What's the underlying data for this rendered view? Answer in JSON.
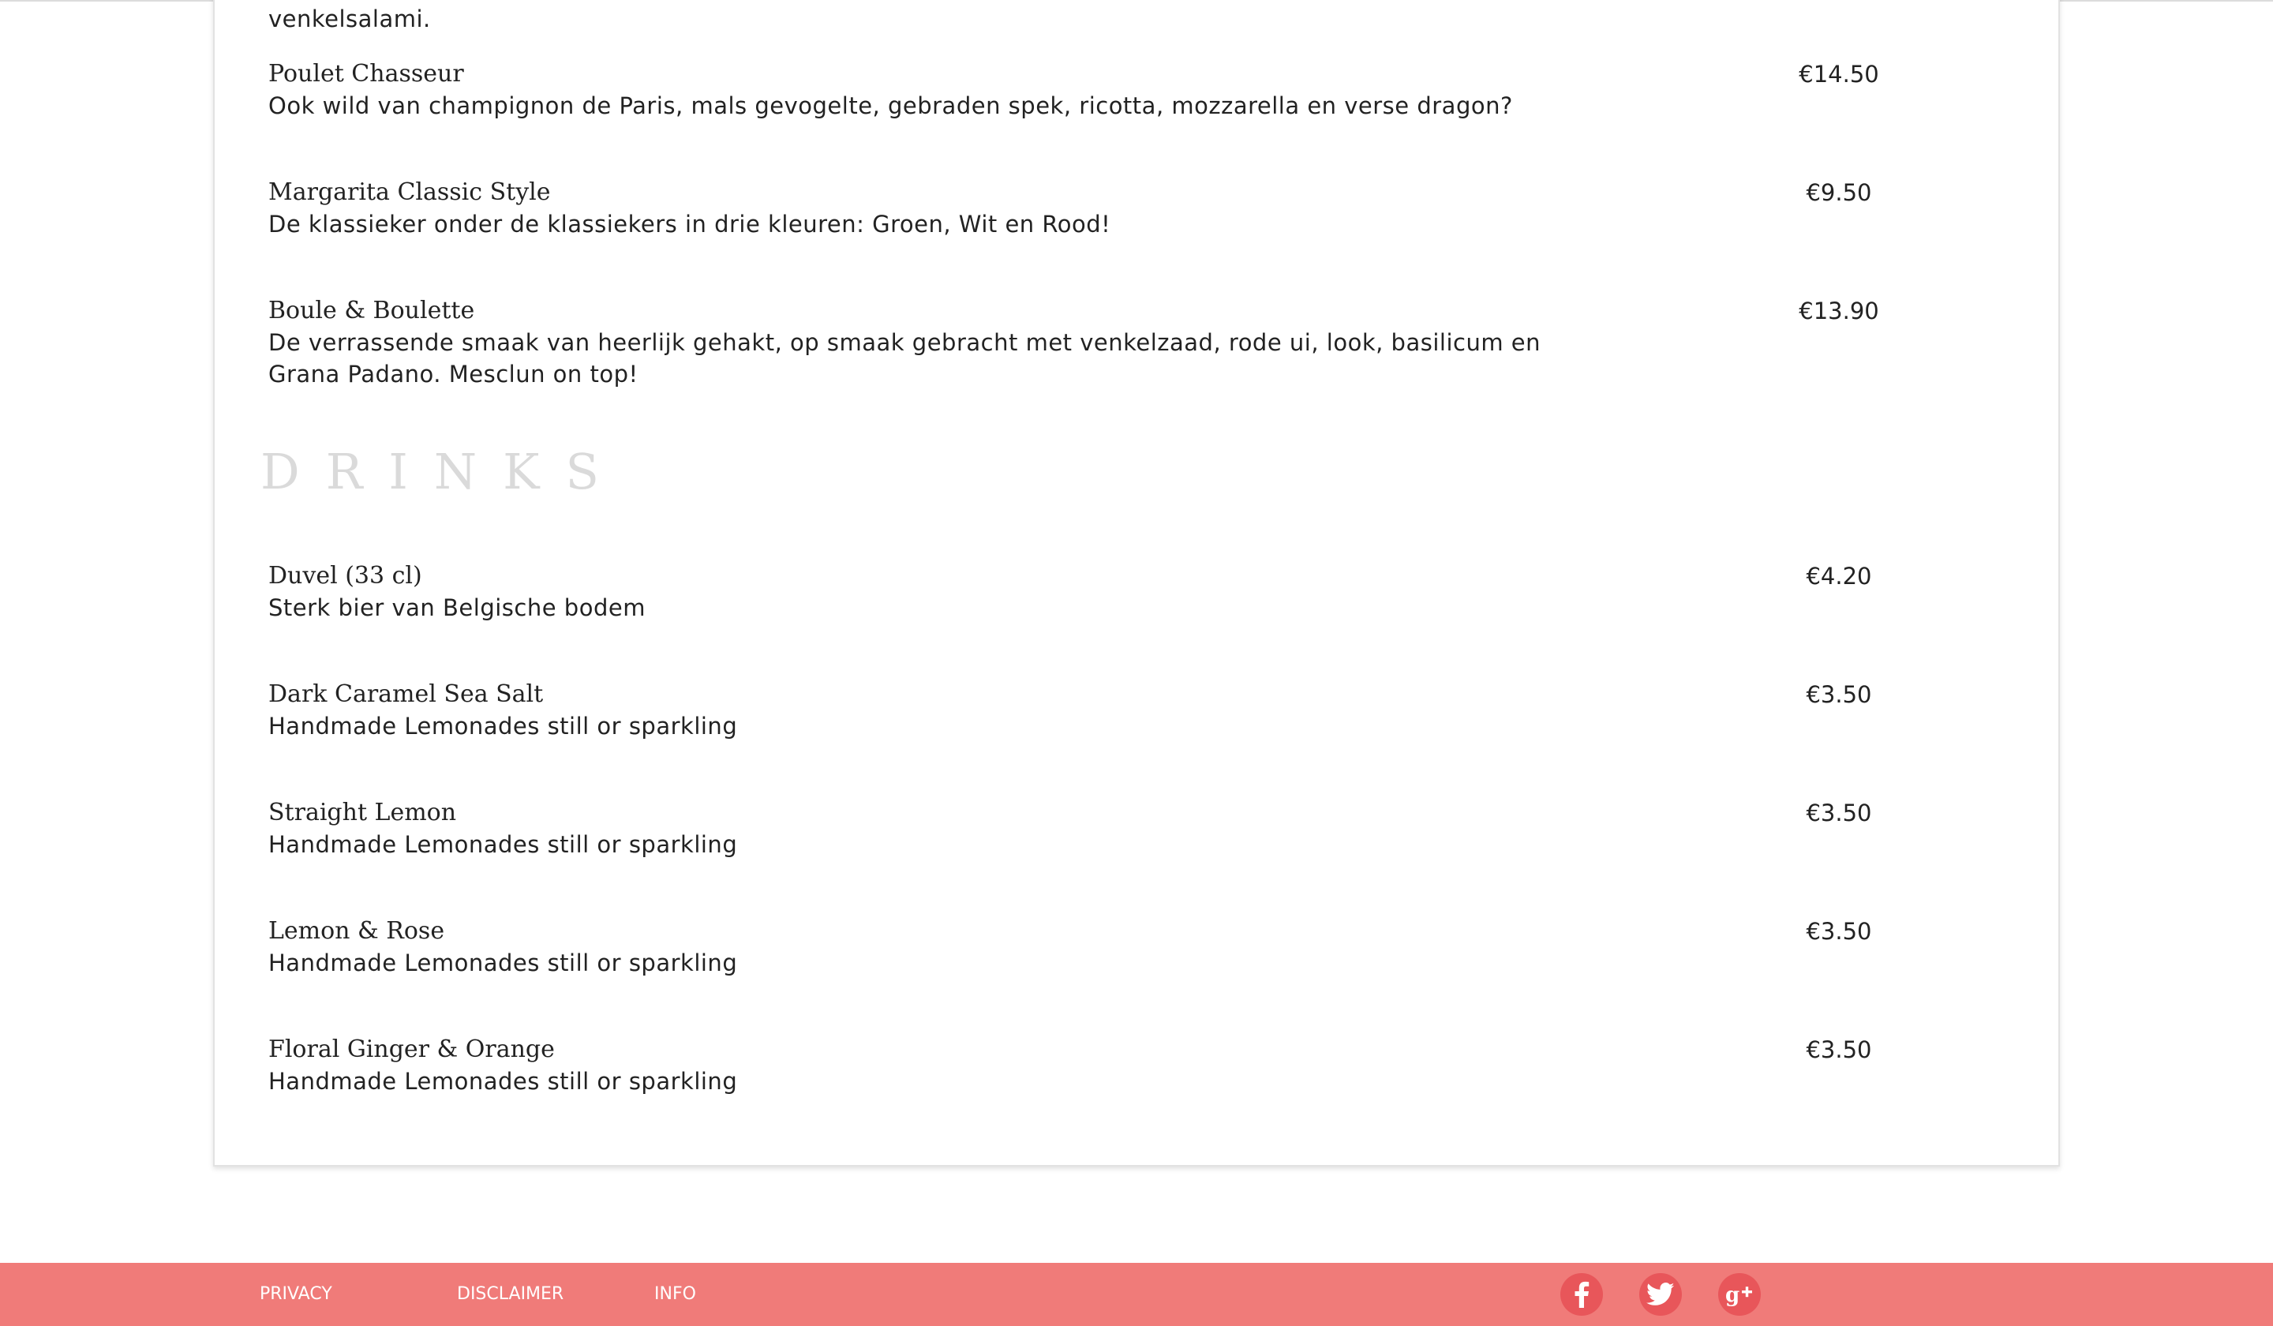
{
  "menu": {
    "truncated_line": "venkelsalami.",
    "food_items": [
      {
        "name": "Poulet Chasseur",
        "description": "Ook wild van champignon de Paris, mals gevogelte, gebraden spek, ricotta, mozzarella en verse dragon?",
        "price": "€14.50"
      },
      {
        "name": "Margarita Classic Style",
        "description": "De klassieker onder de klassiekers in drie kleuren: Groen, Wit en Rood!",
        "price": "€9.50"
      },
      {
        "name": "Boule & Boulette",
        "description_lines": [
          "De verrassende smaak van heerlijk gehakt, op smaak gebracht met venkelzaad, rode ui, look, basilicum en",
          "Grana Padano. Mesclun on top!"
        ],
        "price": "€13.90"
      }
    ],
    "drinks_title": "DRINKS",
    "drink_items": [
      {
        "name": "Duvel (33 cl)",
        "description": "Sterk bier van Belgische bodem",
        "price": "€4.20"
      },
      {
        "name": "Dark Caramel Sea Salt",
        "description": "Handmade Lemonades still or sparkling",
        "price": "€3.50"
      },
      {
        "name": "Straight Lemon",
        "description": "Handmade Lemonades still or sparkling",
        "price": "€3.50"
      },
      {
        "name": "Lemon & Rose",
        "description": "Handmade Lemonades still or sparkling",
        "price": "€3.50"
      },
      {
        "name": "Floral Ginger & Orange",
        "description": "Handmade Lemonades still or sparkling",
        "price": "€3.50"
      }
    ]
  },
  "footer": {
    "links": [
      "PRIVACY",
      "DISCLAIMER",
      "INFO"
    ],
    "social_icons": [
      "facebook-icon",
      "twitter-icon",
      "google-plus-icon"
    ]
  },
  "colors": {
    "footer_background": "#f07b79",
    "social_icon_background": "#e8565a",
    "section_title": "#dadada",
    "text": "#222222"
  }
}
